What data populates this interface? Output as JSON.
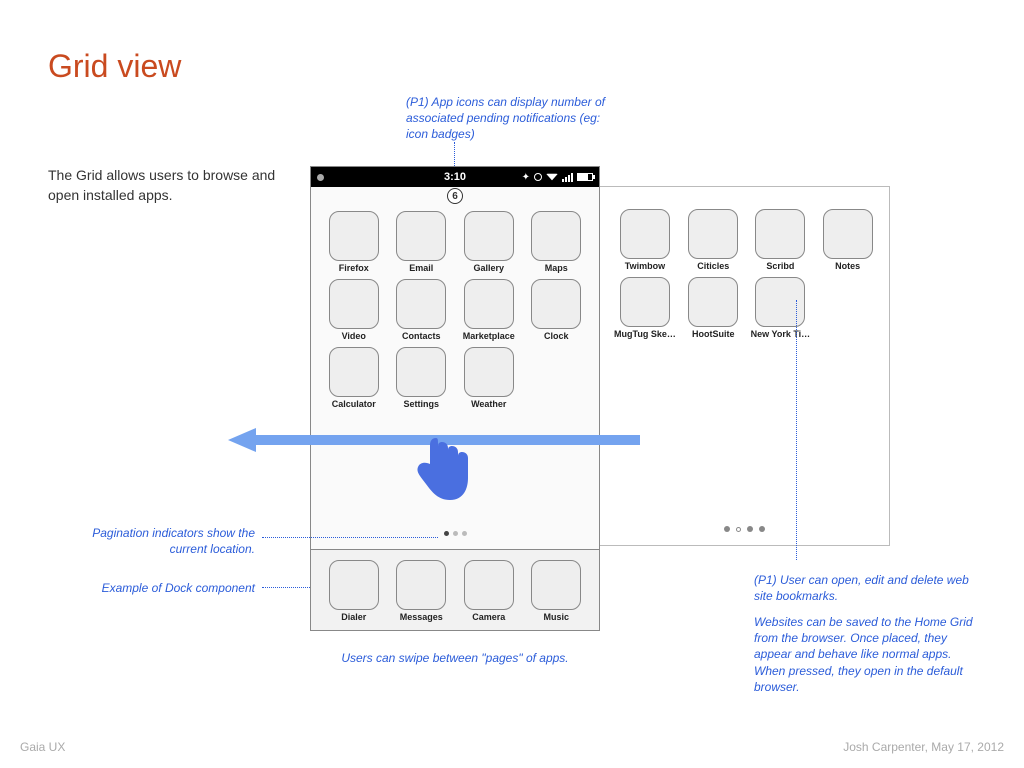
{
  "title": "Grid view",
  "subtitle": "The Grid allows users to browse and open installed apps.",
  "status": {
    "time": "3:10"
  },
  "badge": "6",
  "page1_apps": [
    "Firefox",
    "Email",
    "Gallery",
    "Maps",
    "Video",
    "Contacts",
    "Marketplace",
    "Clock",
    "Calculator",
    "Settings",
    "Weather"
  ],
  "dock_apps": [
    "Dialer",
    "Messages",
    "Camera",
    "Music"
  ],
  "page2_apps": [
    "Twimbow",
    "Citicles",
    "Scribd",
    "Notes",
    "MugTug Ske…",
    "HootSuite",
    "New York Ti…"
  ],
  "anno_badge": "(P1) App icons can display number of associated pending notifications (eg: icon badges)",
  "anno_pager": "Pagination indicators show the current location.",
  "anno_dock": "Example of Dock component",
  "anno_swipe": "Users can swipe between \"pages\" of apps.",
  "anno_bookmarks_1": "(P1) User can open, edit and delete web site bookmarks.",
  "anno_bookmarks_2": "Websites can be saved to the Home Grid from the browser. Once placed, they appear and behave like normal apps. When pressed, they open in the default browser.",
  "footer_left": "Gaia UX",
  "footer_right": "Josh Carpenter, May 17, 2012"
}
